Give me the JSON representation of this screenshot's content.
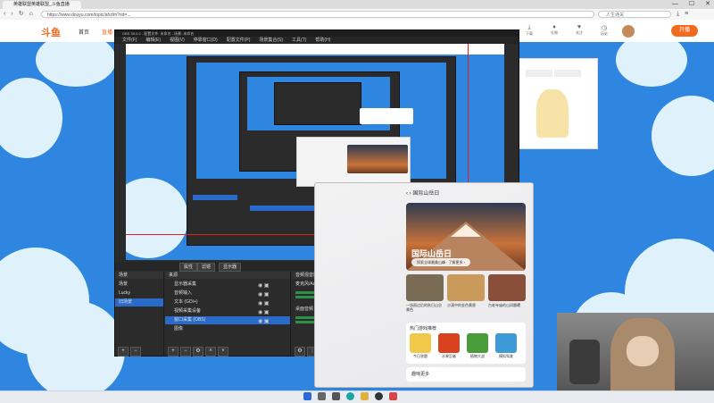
{
  "browser": {
    "tab_title": "英雄联盟英雄联盟_斗鱼直播",
    "window_controls": [
      "—",
      "☐",
      "✕"
    ],
    "url": "https://www.douyu.com/topic/ahzlm?rid=...",
    "search_placeholder": "人生通关",
    "nav_icons": [
      "back-icon",
      "forward-icon",
      "refresh-icon",
      "home-icon"
    ]
  },
  "site": {
    "logo": "斗鱼",
    "nav_home": "首页",
    "nav_live": "直播",
    "header_icons": [
      {
        "icon": "download-icon",
        "label": "下载"
      },
      {
        "icon": "gift-icon",
        "label": "礼物"
      },
      {
        "icon": "follow-icon",
        "label": "关注"
      },
      {
        "icon": "history-icon",
        "label": "历史"
      },
      {
        "icon": "message-icon",
        "label": "消息"
      }
    ],
    "open_live_button": "开播"
  },
  "obs": {
    "title": "OBS 30.0.2 - 配置文件: 未命名 - 场景: 未命名",
    "menu": [
      "文件(F)",
      "编辑(E)",
      "视图(V)",
      "停靠窗口(D)",
      "配置文件(P)",
      "场景集合(S)",
      "工具(T)",
      "帮助(H)"
    ],
    "toolbar_buttons": [
      "属性",
      "滤镜",
      "显示器"
    ],
    "scenes_header": "场景",
    "scenes": [
      "场景",
      "Lucky",
      "旧场景"
    ],
    "sources_header": "来源",
    "sources": [
      "显示器采集",
      "音频输入",
      "文本 (GDI+)",
      "视频采集设备",
      "窗口采集 (OBS)",
      "图像"
    ],
    "mixer_header": "音频混音器",
    "mixer_items": [
      "麦克风/Aux",
      "桌面音频"
    ],
    "selected_source_index": 4
  },
  "popup": {
    "nav_label": "‹  ›  国际山岳日",
    "hero_title": "国际山岳日",
    "hero_sub": "探索全球最美山峰 · 了解更多 ›",
    "news": [
      {
        "caption": "一场雨过后的秋日山谷景色",
        "color": "#7a6b54"
      },
      {
        "caption": "沙漠中的金色黄昏",
        "color": "#c99a5a"
      },
      {
        "caption": "古老寺庙的山间晨曦",
        "color": "#8a4f38"
      }
    ],
    "games_title": "热门游戏推荐",
    "games": [
      {
        "caption": "今日答题",
        "color": "#f2c84b"
      },
      {
        "caption": "水果忍者",
        "color": "#d9421f"
      },
      {
        "caption": "植物大战",
        "color": "#4a9c3a"
      },
      {
        "caption": "模拟驾驶",
        "color": "#3e9ad6"
      }
    ],
    "footer": "趣味更多"
  },
  "webcam": {
    "label": "webcam-feed"
  },
  "taskbar": {
    "icons": [
      {
        "name": "windows-start-icon",
        "color": "#2a6bd9"
      },
      {
        "name": "search-icon",
        "color": "#666"
      },
      {
        "name": "taskview-icon",
        "color": "#555"
      },
      {
        "name": "edge-icon",
        "color": "#1aa3a3"
      },
      {
        "name": "explorer-icon",
        "color": "#e2b13c"
      },
      {
        "name": "obs-icon",
        "color": "#333"
      },
      {
        "name": "store-icon",
        "color": "#d94545"
      }
    ]
  }
}
